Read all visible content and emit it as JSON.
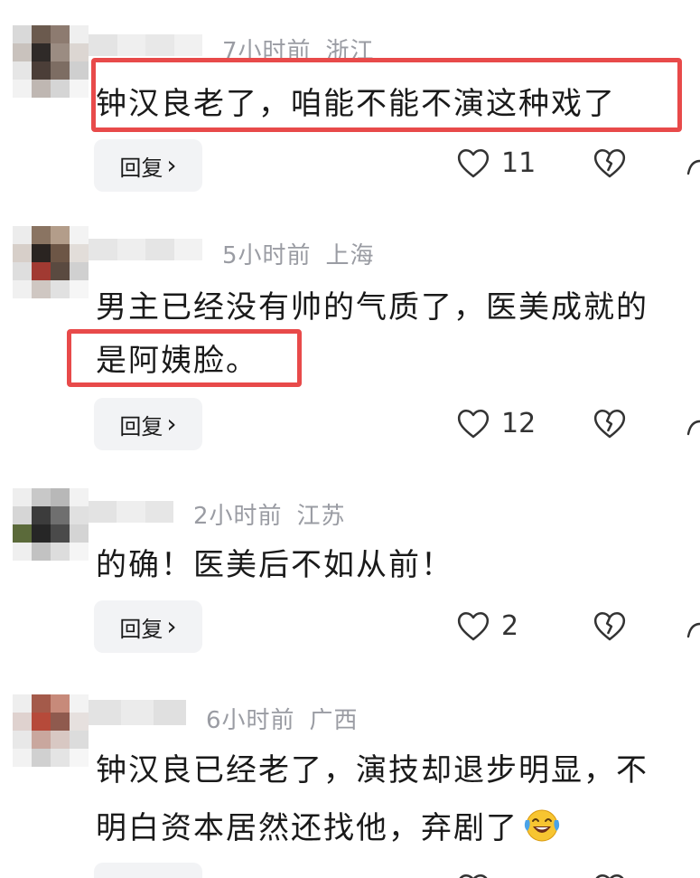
{
  "comments": [
    {
      "time": "7小时前",
      "location": "浙江",
      "lines": [
        "钟汉良老了，咱能不能不演这种戏了"
      ],
      "reply_label": "回复",
      "likes": "11"
    },
    {
      "time": "5小时前",
      "location": "上海",
      "lines": [
        "男主已经没有帅的气质了，医美成就的",
        "是阿姨脸。"
      ],
      "reply_label": "回复",
      "likes": "12"
    },
    {
      "time": "2小时前",
      "location": "江苏",
      "lines": [
        "的确！医美后不如从前！"
      ],
      "reply_label": "回复",
      "likes": "2"
    },
    {
      "username_partial": "Y量 35",
      "time": "6小时前",
      "location": "广西",
      "lines": [
        "钟汉良已经老了，演技却退步明显，不",
        "明白资本居然还找他，弃剧了"
      ],
      "reply_label": "回复",
      "likes": ""
    }
  ],
  "icons": {
    "like": "heart-outline-icon",
    "dislike": "broken-heart-outline-icon",
    "share": "share-icon",
    "emoji": "laughing-crying-emoji"
  },
  "colors": {
    "highlight": "#e84a4a",
    "meta": "#9a9ca3",
    "reply_bg": "#f2f3f5"
  }
}
